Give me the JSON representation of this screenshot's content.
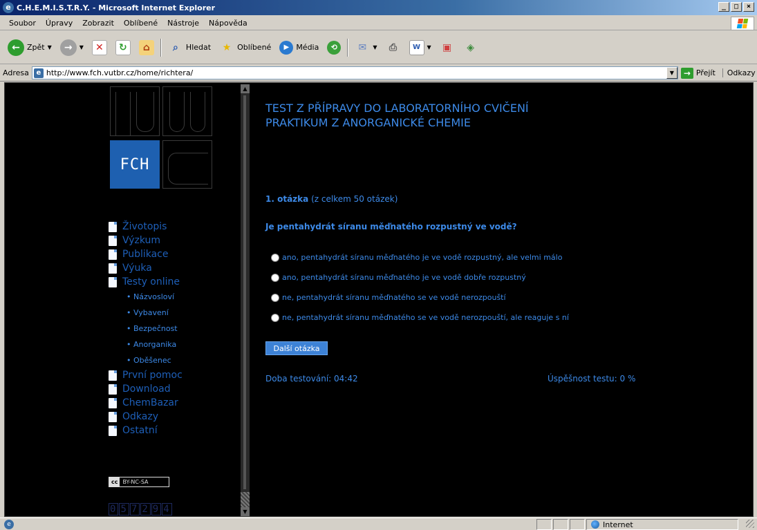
{
  "window": {
    "title": "C.H.E.M.I.S.T.R.Y. - Microsoft Internet Explorer",
    "buttons": {
      "minimize": "_",
      "maximize": "□",
      "close": "×"
    }
  },
  "menu": [
    "Soubor",
    "Úpravy",
    "Zobrazit",
    "Oblíbené",
    "Nástroje",
    "Nápověda"
  ],
  "toolbar": {
    "back_label": "Zpět",
    "search_label": "Hledat",
    "favorites_label": "Oblíbené",
    "media_label": "Média"
  },
  "address": {
    "label": "Adresa",
    "url": "http://www.fch.vutbr.cz/home/richtera/",
    "go_label": "Přejít",
    "links_label": "Odkazy"
  },
  "sidebar": {
    "logo_text": "FCH",
    "items": [
      {
        "label": "Životopis"
      },
      {
        "label": "Výzkum"
      },
      {
        "label": "Publikace"
      },
      {
        "label": "Výuka"
      },
      {
        "label": "Testy online"
      }
    ],
    "sub_items": [
      {
        "label": "• Názvosloví"
      },
      {
        "label": "• Vybavení"
      },
      {
        "label": "• Bezpečnost"
      },
      {
        "label": "• Anorganika"
      },
      {
        "label": "• Oběšenec"
      }
    ],
    "items_after": [
      {
        "label": "První pomoc"
      },
      {
        "label": "Download"
      },
      {
        "label": "ChemBazar"
      },
      {
        "label": "Odkazy"
      },
      {
        "label": "Ostatní"
      }
    ],
    "license_cc": "cc",
    "license_text": "BY-NC-SA",
    "counter_digits": [
      "0",
      "5",
      "7",
      "2",
      "9",
      "4"
    ]
  },
  "main": {
    "heading_line1": "TEST Z PŘÍPRAVY DO LABORATORNÍHO CVIČENÍ",
    "heading_line2": "PRAKTIKUM Z ANORGANICKÉ CHEMIE",
    "question_number": "1. otázka",
    "question_total": "(z celkem 50 otázek)",
    "question_text": "Je pentahydrát síranu měďnatého rozpustný ve vodě?",
    "answers": [
      "ano, pentahydrát síranu měďnatého je ve vodě rozpustný, ale velmi málo",
      "ano, pentahydrát síranu měďnatého je ve vodě dobře rozpustný",
      "ne, pentahydrát síranu měďnatého se ve vodě nerozpouští",
      "ne, pentahydrát síranu měďnatého se ve vodě nerozpouští, ale reaguje s ní"
    ],
    "next_button": "Další otázka",
    "timer": "Doba testování: 04:42",
    "score": "Úspěšnost testu: 0 %"
  },
  "status": {
    "zone": "Internet"
  },
  "colors": {
    "accent": "#3d8ae8",
    "page_background": "#000000",
    "logo_blue": "#1e60b0"
  }
}
